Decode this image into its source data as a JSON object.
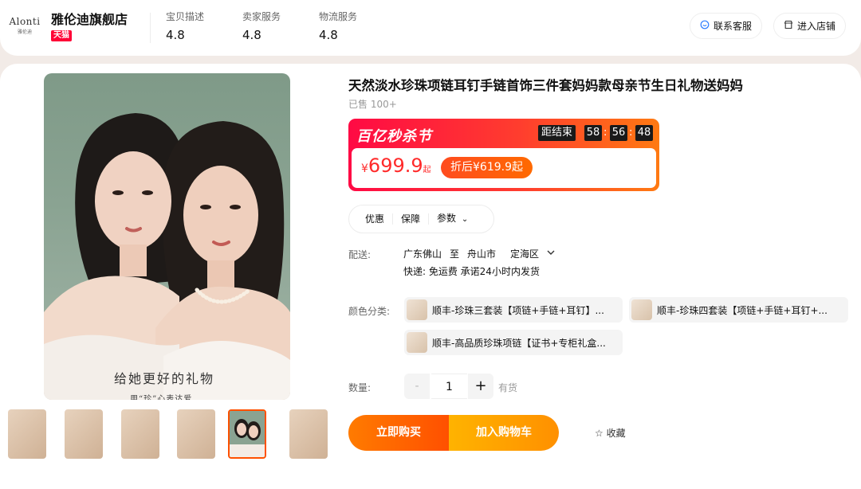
{
  "store": {
    "logo_text": "Alonti",
    "logo_sub": "雅伦迪",
    "name": "雅伦迪旗舰店",
    "badge": "天猫",
    "ratings": [
      {
        "label": "宝贝描述",
        "value": "4.8"
      },
      {
        "label": "卖家服务",
        "value": "4.8"
      },
      {
        "label": "物流服务",
        "value": "4.8"
      }
    ],
    "contact_button": "联系客服",
    "enter_store_button": "进入店铺"
  },
  "product": {
    "title": "天然淡水珍珠项链耳钉手链首饰三件套妈妈款母亲节生日礼物送妈妈",
    "sold": "已售 100+",
    "image_caption": "给她更好的礼物",
    "image_subcaption": "用“珍”心表达爱"
  },
  "promo": {
    "name": "百亿秒杀节",
    "countdown_label": "距结束",
    "countdown": [
      "58",
      "56",
      "48"
    ],
    "currency": "¥",
    "price": "699.9",
    "price_suffix": "起",
    "discount_text": "折后¥619.9起"
  },
  "tabs": [
    "优惠",
    "保障",
    "参数"
  ],
  "delivery": {
    "label": "配送:",
    "from": "广东佛山",
    "to_word": "至",
    "city": "舟山市",
    "district": "定海区",
    "shipping": "快递: 免运费  承诺24小时内发货"
  },
  "color": {
    "label": "颜色分类:",
    "options": [
      "顺丰-珍珠三套装【项链+手链+耳钉】...",
      "顺丰-珍珠四套装【项链+手链+耳钉+...",
      "顺丰-高品质珍珠项链【证书+专柜礼盒..."
    ]
  },
  "quantity": {
    "label": "数量:",
    "minus": "-",
    "value": "1",
    "plus": "+",
    "stock": "有货"
  },
  "actions": {
    "buy": "立即购买",
    "cart": "加入购物车",
    "favorite": "收藏"
  },
  "colors": {
    "accent": "#ff5000",
    "tmall_red": "#ff0036",
    "price_red": "#ff2a2a"
  }
}
